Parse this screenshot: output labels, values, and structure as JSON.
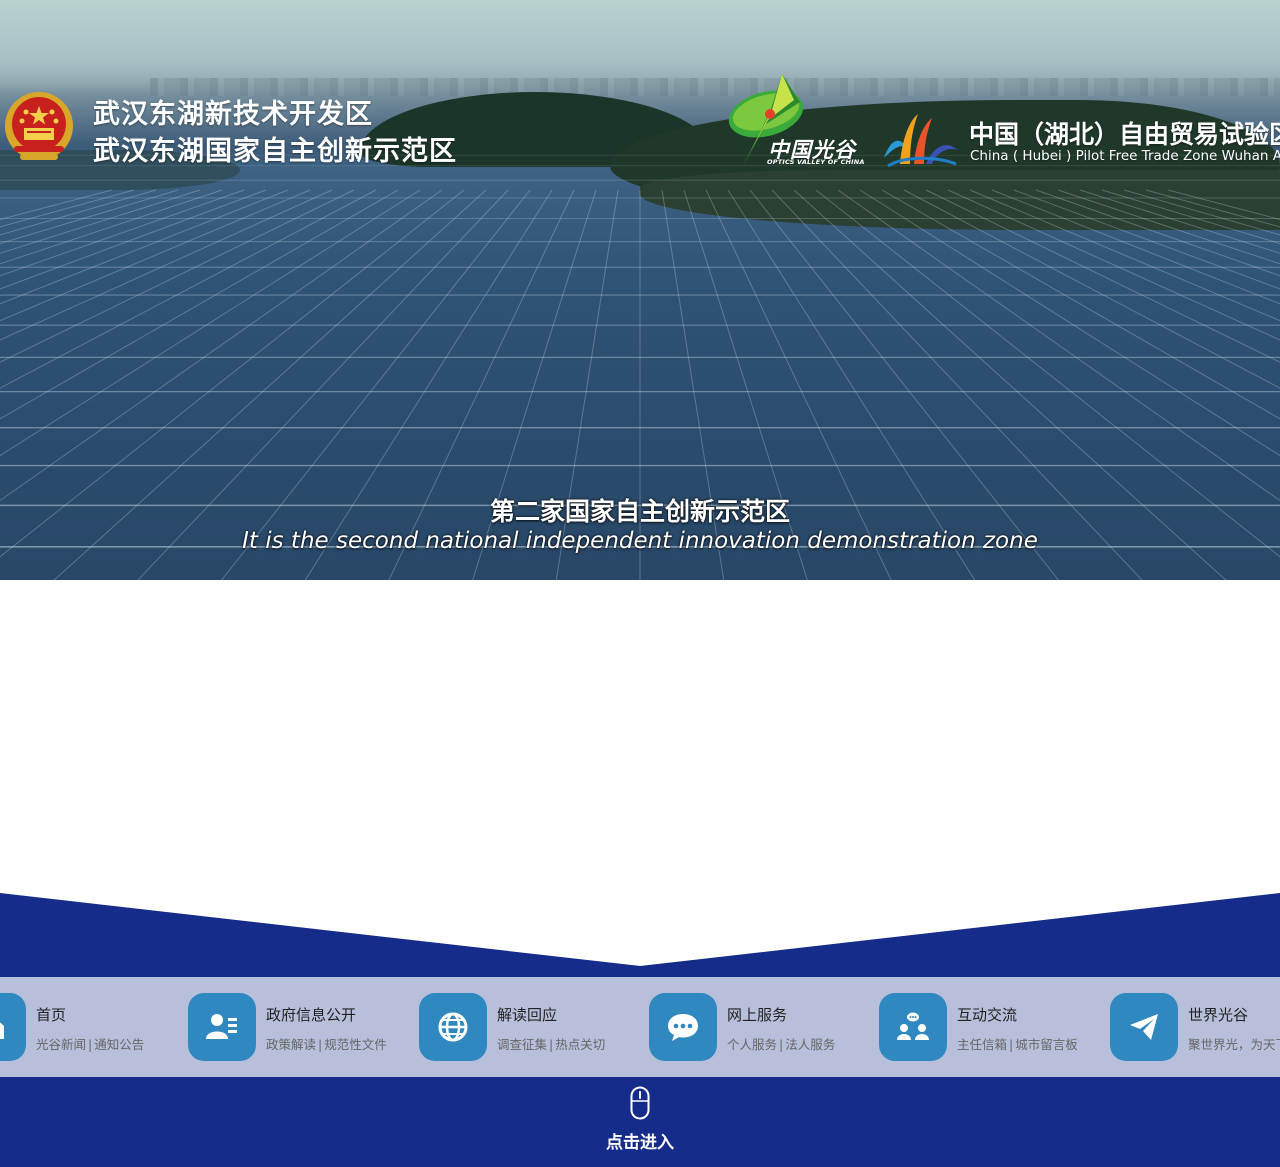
{
  "header": {
    "left_title_line1": "武汉东湖新技术开发区",
    "left_title_line2": "武汉东湖国家自主创新示范区",
    "ovc_name": "中国光谷",
    "ovc_sub": "OPTICS VALLEY OF CHINA",
    "ftz_name": "中国（湖北）自由贸易试验区武汉片区",
    "ftz_sub": "China ( Hubei ) Pilot Free Trade Zone Wuhan Area"
  },
  "hero": {
    "caption_cn": "第二家国家自主创新示范区",
    "caption_en": "It is the second national independent innovation demonstration zone"
  },
  "nav": [
    {
      "title": "首页",
      "desc1": "光谷新闻",
      "desc2": "通知公告",
      "icon": "home-icon"
    },
    {
      "title": "政府信息公开",
      "desc1": "政策解读",
      "desc2": "规范性文件",
      "icon": "user-list-icon"
    },
    {
      "title": "解读回应",
      "desc1": "调查征集",
      "desc2": "热点关切",
      "icon": "globe-icon"
    },
    {
      "title": "网上服务",
      "desc1": "个人服务",
      "desc2": "法人服务",
      "icon": "chat-bubble-icon"
    },
    {
      "title": "互动交流",
      "desc1": "主任信箱",
      "desc2": "城市留言板",
      "icon": "people-chat-icon"
    },
    {
      "title": "世界光谷",
      "desc1": "聚世界光，为天下谷",
      "desc2": "",
      "icon": "paper-plane-icon"
    }
  ],
  "separator": "|",
  "footer": {
    "enter_label": "点击进入",
    "enter_icon": "mouse-icon"
  },
  "colors": {
    "brand_navy": "#162c8a",
    "nav_bg": "#b8bfdb",
    "icon_blue": "#2f88c0"
  }
}
